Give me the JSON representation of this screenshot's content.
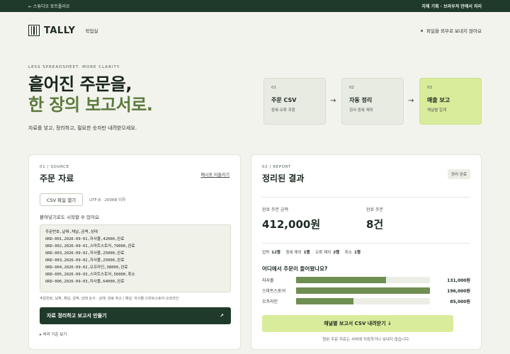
{
  "topbar": {
    "back": "← 스튜디오 포트폴리오",
    "right": "자체 기획 · 브라우저 안에서 처리"
  },
  "header": {
    "logo": "TALLY",
    "nav": "작업실",
    "privacy": "파일을 외부로 보내지 않아요"
  },
  "hero": {
    "eyebrow": "LESS SPREADSHEET. MORE CLARITY.",
    "line1": "흩어진 주문을,",
    "line2": "한 장의 보고서로.",
    "sub": "자료를 넣고, 정리하고, 필요한 숫자만 내려받으세요."
  },
  "steps": [
    {
      "num": "01",
      "title": "주문 CSV",
      "sub": "중복·오류 포함"
    },
    {
      "num": "02",
      "title": "자동 정리",
      "sub": "검사·중복 제외"
    },
    {
      "num": "03",
      "title": "매출 보고",
      "sub": "채널별 집계"
    }
  ],
  "arrows": [
    "→",
    "→"
  ],
  "source": {
    "eyebrow": "01 / SOURCE",
    "title": "주문 자료",
    "example_link": "예시로 되돌리기",
    "file_button": "CSV 파일 열기",
    "file_note": "UTF-8 · 200KB 이하",
    "paste_label": "붙여넣기로도 시작할 수 있어요",
    "csv": "주문번호,날짜,채널,금액,상태\nORD-001,2026-09-01,자사몰,42000,완료\nORD-002,2026-09-01,스마트스토어,79000,완료\nORD-003,2026-09-02,자사몰,25000,완료\nORD-003,2026-09-02,자사몰,25000,완료\nORD-004,2026-09-02,오프라인,38000,완료\nORD-005,2026-09-03,스마트스토어,56000,취소\nORD-006,2026-09-03,자사몰,64000,완료",
    "hint": "주문번호, 날짜, 채널, 금액, 상태 순서 · 상태: 완료 취소 / 채널: 자사몰·스마트스토어·오프라인",
    "submit": "자료 정리하고 보고서 만들기",
    "submit_arrow": "↗",
    "criteria": "▸ 처리 기준 보기"
  },
  "report": {
    "eyebrow": "02 / REPORT",
    "title": "정리된 결과",
    "badge": "정리 완료",
    "metrics": [
      {
        "label": "완료 주문 금액",
        "value": "412,000원"
      },
      {
        "label": "완료 주문",
        "value": "8건"
      }
    ],
    "stats": [
      {
        "k": "입력",
        "v": "12행"
      },
      {
        "k": "중복 제외",
        "v": "1행"
      },
      {
        "k": "오류 제외",
        "v": "2행"
      },
      {
        "k": "취소",
        "v": "1행"
      }
    ],
    "channel_title": "어디에서 주문이 들어왔나요?",
    "channels": [
      {
        "name": "자사몰",
        "value": "131,000원",
        "share": 0.67
      },
      {
        "name": "스마트스토어",
        "value": "196,000원",
        "share": 1.0
      },
      {
        "name": "오프라인",
        "value": "85,000원",
        "share": 0.43
      }
    ],
    "download": "채널별 보고서 CSV 내려받기 ↓",
    "note": "원본 주문 자료는 서버에 저장하거나 보내지 않습니다."
  }
}
